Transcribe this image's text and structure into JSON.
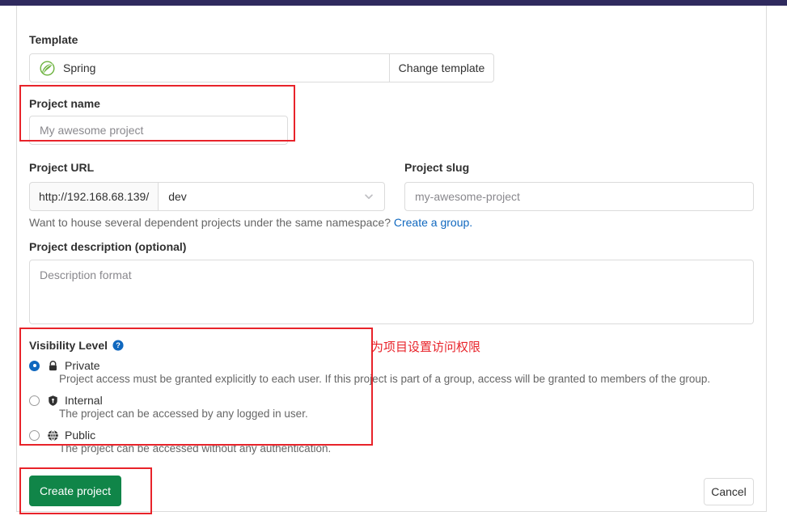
{
  "theme": {
    "topbar_color": "#2f2a5e",
    "annotation_color": "#e8232a",
    "link_color": "#1068bf",
    "primary_button_color": "#108548",
    "border_color": "#dbdbdb"
  },
  "template": {
    "label": "Template",
    "name": "Spring",
    "icon": "spring-leaf-icon",
    "change_button": "Change template"
  },
  "project_name": {
    "label": "Project name",
    "value": "",
    "placeholder": "My awesome project"
  },
  "project_url": {
    "label": "Project URL",
    "prefix": "http://192.168.68.139/",
    "namespace": "dev",
    "dropdown_icon": "chevron-down-icon"
  },
  "project_slug": {
    "label": "Project slug",
    "value": "",
    "placeholder": "my-awesome-project"
  },
  "namespace_hint": {
    "text": "Want to house several dependent projects under the same namespace?",
    "link_text": "Create a group."
  },
  "project_description": {
    "label": "Project description (optional)",
    "value": "",
    "placeholder": "Description format"
  },
  "visibility": {
    "title": "Visibility Level",
    "help_icon": "help-circle-icon",
    "selected": "private",
    "options": [
      {
        "id": "private",
        "icon": "lock-icon",
        "name": "Private",
        "description": "Project access must be granted explicitly to each user. If this project is part of a group, access will be granted to members of the group.",
        "checked": true
      },
      {
        "id": "internal",
        "icon": "shield-icon",
        "name": "Internal",
        "description": "The project can be accessed by any logged in user.",
        "checked": false
      },
      {
        "id": "public",
        "icon": "globe-icon",
        "name": "Public",
        "description": "The project can be accessed without any authentication.",
        "checked": false
      }
    ]
  },
  "annotation": {
    "visibility_note": "为项目设置访问权限"
  },
  "footer": {
    "create_label": "Create project",
    "cancel_label": "Cancel"
  }
}
